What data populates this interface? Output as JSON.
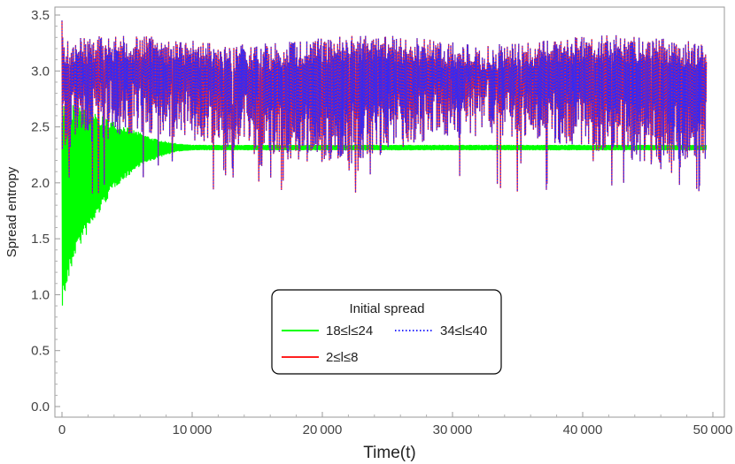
{
  "chart_data": {
    "type": "line",
    "xlabel": "Time(t)",
    "ylabel": "Spread entropy",
    "xlim": [
      0,
      50000
    ],
    "ylim": [
      0,
      3.5
    ],
    "x_ticks": [
      0,
      10000,
      20000,
      30000,
      40000,
      50000
    ],
    "x_tick_labels": [
      "0",
      "10 000",
      "20 000",
      "30 000",
      "40 000",
      "50 000"
    ],
    "y_ticks": [
      0.0,
      0.5,
      1.0,
      1.5,
      2.0,
      2.5,
      3.0,
      3.5
    ],
    "y_tick_labels": [
      "0.0",
      "0.5",
      "1.0",
      "1.5",
      "2.0",
      "2.5",
      "3.0",
      "3.5"
    ],
    "grid": false,
    "legend": {
      "title": "Initial spread",
      "placement": "bottom-center"
    },
    "series": [
      {
        "name": "18≤l≤24",
        "color": "#00ff00",
        "style": "solid",
        "description_values": {
          "x": [
            0,
            500,
            1000,
            2000,
            3000,
            4000,
            5000,
            6000,
            7000,
            8000,
            9000,
            10000,
            20000,
            30000,
            40000,
            49500
          ],
          "upper": [
            2.75,
            2.72,
            2.7,
            2.65,
            2.6,
            2.55,
            2.5,
            2.45,
            2.4,
            2.37,
            2.35,
            2.34,
            2.34,
            2.34,
            2.34,
            2.34
          ],
          "lower": [
            0.87,
            1.1,
            1.35,
            1.55,
            1.75,
            1.95,
            2.05,
            2.15,
            2.2,
            2.25,
            2.28,
            2.29,
            2.29,
            2.29,
            2.29,
            2.29
          ]
        }
      },
      {
        "name": "2≤l≤8",
        "color": "#ff2020",
        "style": "solid",
        "description_values": {
          "x": [
            0,
            49500
          ],
          "upper": [
            3.45,
            3.3
          ],
          "lower": [
            1.9,
            2.15
          ],
          "mean": 3.0
        }
      },
      {
        "name": "34≤l≤40",
        "color": "#2a2aff",
        "style": "dotted",
        "description_values": {
          "x": [
            0,
            49500
          ],
          "upper": [
            3.45,
            3.3
          ],
          "lower": [
            1.9,
            2.15
          ],
          "mean": 3.0
        }
      }
    ]
  }
}
